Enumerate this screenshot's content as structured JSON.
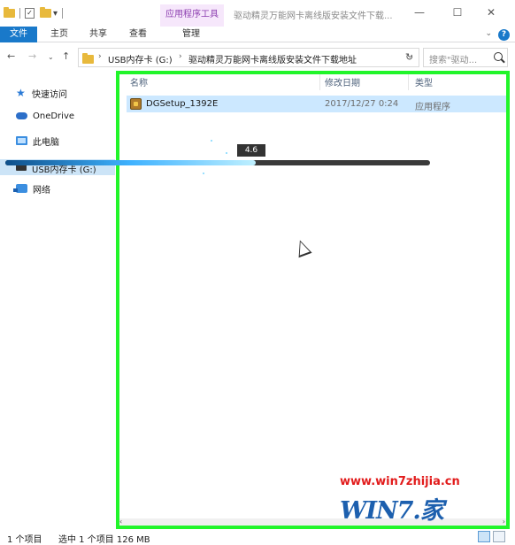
{
  "window": {
    "context_tab": "应用程序工具",
    "title": "驱动精灵万能网卡离线版安装文件下载...",
    "minimize": "—",
    "maximize": "☐",
    "close": "✕"
  },
  "ribbon": {
    "tabs": [
      "文件",
      "主页",
      "共享",
      "查看",
      "管理"
    ],
    "expand": "⌄",
    "help": "?"
  },
  "address": {
    "crumbs": [
      "USB内存卡 (G:)",
      "驱动精灵万能网卡离线版安装文件下载地址"
    ],
    "search_placeholder": "搜索\"驱动..."
  },
  "sidebar": {
    "items": [
      "快速访问",
      "OneDrive",
      "此电脑",
      "USB内存卡 (G:)",
      "网络"
    ]
  },
  "columns": [
    "名称",
    "修改日期",
    "类型"
  ],
  "files": [
    {
      "name": "DGSetup_1392E",
      "modified": "2017/12/27 0:24",
      "type": "应用程序"
    }
  ],
  "video": {
    "tooltip": "4.6",
    "progress": 0.59,
    "accent": "#21f52a"
  },
  "status": {
    "count": "1 个项目",
    "selected": "选中 1 个项目  126 MB"
  },
  "watermark": {
    "url": "www.win7zhijia.cn",
    "logo_prefix": "WIN7",
    "logo_suffix": "家"
  }
}
